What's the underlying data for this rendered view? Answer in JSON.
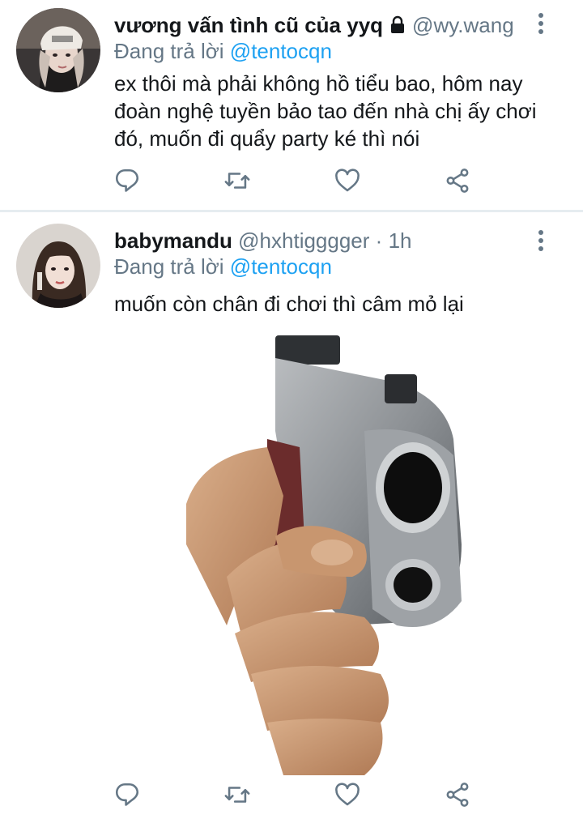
{
  "tweets": [
    {
      "display_name": "vương vấn tình cũ của yyq",
      "protected_icon": "lock-icon",
      "handle": "@wy.wang",
      "time": "",
      "replying_label": "Đang trả lời",
      "replying_to": "@tentocqn",
      "text": "ex thôi mà phải không hồ tiểu bao, hôm nay đoàn nghệ tuyền bảo tao đến nhà chị ấy chơi đó, muốn đi quẩy party ké thì nói",
      "actions": [
        "reply-icon",
        "retweet-icon",
        "like-icon",
        "share-icon"
      ]
    },
    {
      "display_name": "babymandu",
      "handle": "@hxhtigggger",
      "separator": "·",
      "time": "1h",
      "replying_label": "Đang trả lời",
      "replying_to": "@tentocqn",
      "text": "muốn còn chân đi chơi thì câm mỏ lại",
      "media": "hand-holding-pistol-image",
      "actions": [
        "reply-icon",
        "retweet-icon",
        "like-icon",
        "share-icon"
      ]
    }
  ],
  "colors": {
    "link": "#1da1f2",
    "secondary_text": "#657786",
    "primary_text": "#14171a",
    "divider": "#e6ecf0"
  }
}
